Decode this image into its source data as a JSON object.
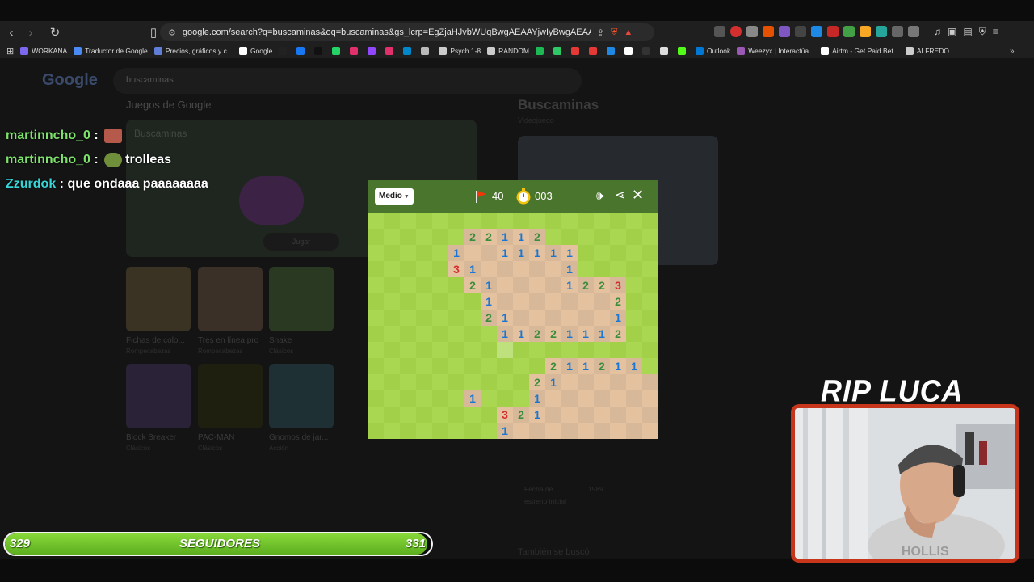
{
  "browser": {
    "url": "google.com/search?q=buscaminas&oq=buscaminas&gs_lcrp=EgZjaHJvbWUqBwgAEAAYjwIyBwgAEAAYjwIyEggBEC4YQxi...",
    "bookmarks": [
      {
        "label": "WORKANA",
        "color": "#7b68ee"
      },
      {
        "label": "Traductor de Google",
        "color": "#4a8af4"
      },
      {
        "label": "Precios, gráficos y c...",
        "color": "#5f7ed6"
      },
      {
        "label": "Google",
        "color": "#ffffff"
      },
      {
        "label": "",
        "color": "#222222"
      },
      {
        "label": "",
        "color": "#1877f2"
      },
      {
        "label": "",
        "color": "#111111"
      },
      {
        "label": "",
        "color": "#25d366"
      },
      {
        "label": "",
        "color": "#e1306c"
      },
      {
        "label": "",
        "color": "#9146ff"
      },
      {
        "label": "",
        "color": "#e1306c"
      },
      {
        "label": "",
        "color": "#0088cc"
      },
      {
        "label": "",
        "color": "#bbbbbb"
      },
      {
        "label": "Psych 1-8",
        "color": "#cccccc"
      },
      {
        "label": "RANDOM",
        "color": "#cccccc"
      },
      {
        "label": "",
        "color": "#1db954"
      },
      {
        "label": "",
        "color": "#2ec866"
      },
      {
        "label": "",
        "color": "#e53935"
      },
      {
        "label": "",
        "color": "#e53935"
      },
      {
        "label": "",
        "color": "#1e88e5"
      },
      {
        "label": "",
        "color": "#ffffff"
      },
      {
        "label": "",
        "color": "#333333"
      },
      {
        "label": "",
        "color": "#dddddd"
      },
      {
        "label": "",
        "color": "#53fc18"
      },
      {
        "label": "Outlook",
        "color": "#0078d4"
      },
      {
        "label": "Weezyx | Interactúa...",
        "color": "#9b59b6"
      },
      {
        "label": "Airtm - Get Paid Bet...",
        "color": "#ffffff"
      },
      {
        "label": "ALFREDO",
        "color": "#cccccc"
      }
    ]
  },
  "google": {
    "query": "buscaminas",
    "section_title": "Juegos de Google",
    "hero_title": "Buscaminas",
    "hero_button": "Jugar",
    "tiles": [
      {
        "label": "Fichas de colo...",
        "sub": "Rompecabezas",
        "color": "#3a3324"
      },
      {
        "label": "Tres en línea pro",
        "sub": "Rompecabezas",
        "color": "#3a3028"
      },
      {
        "label": "Snake",
        "sub": "Clásicos",
        "color": "#2a3a22"
      },
      {
        "label": "Block Breaker",
        "sub": "Clásicos",
        "color": "#2a2338"
      },
      {
        "label": "PAC-MAN",
        "sub": "Clásicos",
        "color": "#1f1f10"
      },
      {
        "label": "Gnomos de jar...",
        "sub": "Acción",
        "color": "#1e3034"
      }
    ],
    "kp_title": "Buscaminas",
    "kp_sub": "Videojuego",
    "kp_year_label": "Fecha de estreno inicial",
    "kp_year": "1989",
    "kp_more": "También se buscó"
  },
  "game": {
    "difficulty": "Medio",
    "flags": "40",
    "time": "003",
    "board": [
      "GGGGGGGGGGGGGGGGGG",
      "GGGGGR22112GGGGGGG",
      "GGGGG1SS11111GGGGG",
      "GGGGG31SSSSS1GGGGG",
      "GGGGGG21SSSS1223GG",
      "GGGGGGG1SSSSSSS2GG",
      "GGGGGGG21SSSSSS1GG",
      "GGGGGGGG11221112GG",
      "GGGGGGGGHGGGGGGGGG",
      "GGGGGGGGGGG211211G",
      "GGGGGGGGGG21SSSSSS",
      "GGGGGG1GGG1SSSSSSS",
      "GGGGGGGG321SSSSSSS",
      "GGGGGGGG1SSSSSSSSS"
    ]
  },
  "chat": [
    {
      "user": "martinncho_0",
      "message": ""
    },
    {
      "user": "martinncho_0",
      "message": "trolleas"
    },
    {
      "user": "Zzurdok",
      "message": "que ondaaa paaaaaaaa"
    }
  ],
  "followers": {
    "current": "329",
    "label": "SEGUIDORES",
    "goal": "331",
    "progress": 0.99
  },
  "webcam": {
    "caption": "RIP LUCA",
    "shirt_text": "HOLLIS"
  }
}
